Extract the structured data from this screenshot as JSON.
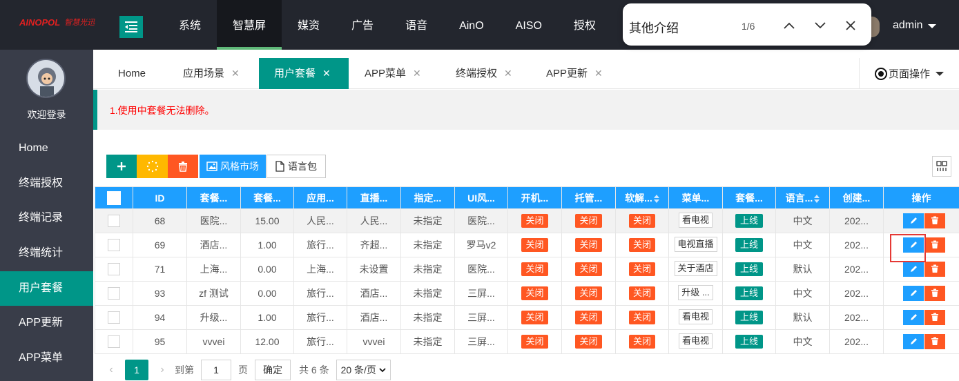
{
  "brand": {
    "name": "AINOPOL",
    "subtitle": "智慧光迅"
  },
  "nav": {
    "items": [
      "系统",
      "智慧屏",
      "媒资",
      "广告",
      "语音",
      "AinO",
      "AISO",
      "授权"
    ],
    "active_index": 1
  },
  "user": {
    "name": "admin"
  },
  "find_bar": {
    "query": "其他介绍",
    "count": "1/6"
  },
  "sidebar": {
    "welcome": "欢迎登录",
    "items": [
      "Home",
      "终端授权",
      "终端记录",
      "终端统计",
      "用户套餐",
      "APP更新",
      "APP菜单"
    ],
    "active_index": 4
  },
  "tabs": {
    "items": [
      "Home",
      "应用场景",
      "用户套餐",
      "APP菜单",
      "终端授权",
      "APP更新"
    ],
    "close": "✕",
    "active_index": 2,
    "page_ops": "页面操作"
  },
  "notice": "1.使用中套餐无法删除。",
  "toolbar": {
    "style_market": "风格市场",
    "language_pack": "语言包"
  },
  "table": {
    "headers": [
      "ID",
      "套餐...",
      "套餐...",
      "应用...",
      "直播...",
      "指定...",
      "UI风...",
      "开机...",
      "托管...",
      "软解...",
      "菜单...",
      "套餐...",
      "语言...",
      "创建...",
      "操作"
    ],
    "rows": [
      {
        "id": "68",
        "name": "医院...",
        "price": "15.00",
        "app": "人民...",
        "live": "人民...",
        "assign": "未指定",
        "ui": "医院...",
        "boot": "关闭",
        "host": "关闭",
        "soft": "关闭",
        "menu": "看电视",
        "status": "上线",
        "lang": "中文",
        "created": "202..."
      },
      {
        "id": "69",
        "name": "酒店...",
        "price": "1.00",
        "app": "旅行...",
        "live": "齐超...",
        "assign": "未指定",
        "ui": "罗马v2",
        "boot": "关闭",
        "host": "关闭",
        "soft": "关闭",
        "menu": "电视直播",
        "status": "上线",
        "lang": "中文",
        "created": "202..."
      },
      {
        "id": "71",
        "name": "上海...",
        "price": "0.00",
        "app": "上海...",
        "live": "未设置",
        "assign": "未指定",
        "ui": "医院...",
        "boot": "关闭",
        "host": "关闭",
        "soft": "关闭",
        "menu": "关于酒店",
        "status": "上线",
        "lang": "默认",
        "created": "202..."
      },
      {
        "id": "93",
        "name": "zf 测试",
        "price": "0.00",
        "app": "旅行...",
        "live": "酒店...",
        "assign": "未指定",
        "ui": "三屏...",
        "boot": "关闭",
        "host": "关闭",
        "soft": "关闭",
        "menu": "升级 ...",
        "status": "上线",
        "lang": "中文",
        "created": "202..."
      },
      {
        "id": "94",
        "name": "升级...",
        "price": "1.00",
        "app": "旅行...",
        "live": "酒店...",
        "assign": "未指定",
        "ui": "三屏...",
        "boot": "关闭",
        "host": "关闭",
        "soft": "关闭",
        "menu": "看电视",
        "status": "上线",
        "lang": "默认",
        "created": "202..."
      },
      {
        "id": "95",
        "name": "vvvei",
        "price": "12.00",
        "app": "旅行...",
        "live": "vvvei",
        "assign": "未指定",
        "ui": "三屏...",
        "boot": "关闭",
        "host": "关闭",
        "soft": "关闭",
        "menu": "看电视",
        "status": "上线",
        "lang": "中文",
        "created": "202..."
      }
    ]
  },
  "pager": {
    "current": "1",
    "goto_label": "到第",
    "goto_value": "1",
    "page_label": "页",
    "confirm": "确定",
    "total": "共 6 条",
    "page_size": "20 条/页"
  },
  "colors": {
    "accent": "#009688",
    "blue": "#1e9fff",
    "danger": "#ff5722",
    "dark": "#23262e",
    "sidebar": "#393d49"
  }
}
